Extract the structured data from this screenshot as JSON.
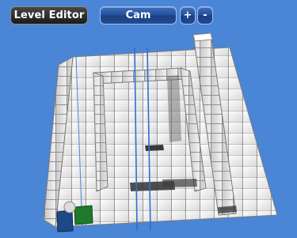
{
  "toolbar": {
    "title": "Level Editor",
    "camera_button_label": "Cam",
    "zoom_in_label": "+",
    "zoom_out_label": "-"
  },
  "scene": {
    "background_color": "#4a85d6",
    "block_color": "#ececec",
    "grid_line_color": "#2f6fd0",
    "player_cube_colors": [
      "#1f7a2c",
      "#1c4a86"
    ],
    "player_sphere_color": "#dcdcdc"
  }
}
